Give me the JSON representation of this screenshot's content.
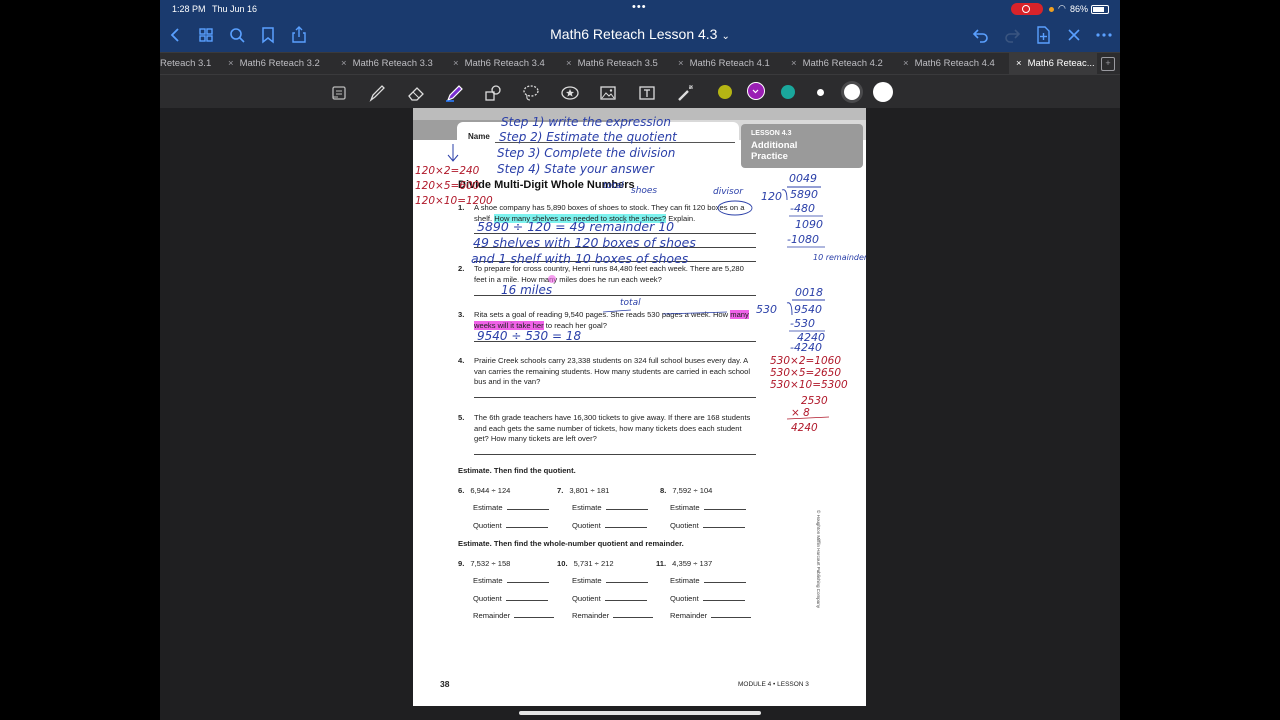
{
  "status_bar": {
    "time": "1:28 PM",
    "date": "Thu Jun 16",
    "battery": "86%"
  },
  "nav": {
    "title": "Math6 Reteach Lesson 4.3",
    "accent_color": "#5aa0ff",
    "icons": [
      "back-icon",
      "grid-icon",
      "search-icon",
      "bookmark-icon",
      "share-icon",
      "undo-icon",
      "redo-icon",
      "add-page-icon",
      "close-icon",
      "more-icon"
    ]
  },
  "tabs": [
    {
      "label": "Reteach 3.1",
      "closable": false
    },
    {
      "label": "Math6 Reteach 3.2",
      "closable": true
    },
    {
      "label": "Math6 Reteach 3.3",
      "closable": true
    },
    {
      "label": "Math6 Reteach 3.4",
      "closable": true
    },
    {
      "label": "Math6 Reteach 3.5",
      "closable": true
    },
    {
      "label": "Math6 Reteach 4.1",
      "closable": true
    },
    {
      "label": "Math6 Reteach 4.2",
      "closable": true
    },
    {
      "label": "Math6 Reteach 4.4",
      "closable": true
    },
    {
      "label": "Math6 Reteac...",
      "closable": true,
      "active": true
    }
  ],
  "toolbar": {
    "tools": [
      "reader-icon",
      "pen-icon",
      "eraser-icon",
      "highlighter-icon",
      "shapes-icon",
      "lasso-icon",
      "sticker-icon",
      "image-icon",
      "text-icon",
      "laser-icon"
    ],
    "colors": [
      "#b5b514",
      "#9a1fb4",
      "#1aa79c",
      "#ffffff",
      "#ffffff",
      "#ffffff"
    ]
  },
  "worksheet": {
    "name_label": "Name",
    "lesson_label": "LESSON 4.3",
    "lesson_title_1": "Additional",
    "lesson_title_2": "Practice",
    "title": "Divide Multi-Digit Whole Numbers",
    "q1": {
      "num": "1.",
      "a": "A shoe company has 5,890 boxes of shoes to stock. They can fit 120 boxes on a shelf.",
      "hl": "How many shelves are needed to stock the shoes?",
      "b": " Explain."
    },
    "q2": {
      "num": "2.",
      "text": "To prepare for cross country, Henri runs 84,480 feet each week. There are 5,280 feet in a mile. How many miles does he run each week?"
    },
    "q3": {
      "num": "3.",
      "a": "Rita sets a goal of reading 9,540 pages. She reads 530 pages a week. How ",
      "hl": "many weeks will it take her",
      "b": " to reach her goal?"
    },
    "q4": {
      "num": "4.",
      "text": "Prairie Creek schools carry 23,338 students on 324 full school buses every day. A van carries the remaining students. How many students are carried in each school bus and in the van?"
    },
    "q5": {
      "num": "5.",
      "text": "The 6th grade teachers have 16,300 tickets to give away. If there are 168 students and each gets the same number of tickets, how many tickets does each student get? How many tickets are left over?"
    },
    "section1": "Estimate. Then find the quotient.",
    "section2": "Estimate. Then find the whole-number quotient and remainder.",
    "problems": [
      {
        "num": "6.",
        "expr": "6,944 ÷ 124"
      },
      {
        "num": "7.",
        "expr": "3,801 ÷ 181"
      },
      {
        "num": "8.",
        "expr": "7,592 ÷ 104"
      },
      {
        "num": "9.",
        "expr": "7,532 ÷ 158"
      },
      {
        "num": "10.",
        "expr": "5,731 ÷ 212"
      },
      {
        "num": "11.",
        "expr": "4,359 ÷ 137"
      }
    ],
    "estimate_label": "Estimate",
    "quotient_label": "Quotient",
    "remainder_label": "Remainder",
    "page_number": "38",
    "footer": "MODULE 4 • LESSON 3",
    "copyright": "© Houghton Mifflin Harcourt Publishing Company"
  },
  "annotations": {
    "steps": [
      "Step 1) write the expression",
      "Step 2) Estimate the quotient",
      "Step 3) Complete the division",
      "Step 4) State your answer"
    ],
    "left_work": [
      "120×2=240",
      "120×5=600",
      "120×10=1200"
    ],
    "q1_work": [
      "total",
      "shoes",
      "divisor"
    ],
    "q1_answer_1": "5890 ÷ 120 = 49 remainder 10",
    "q1_answer_2": "49 shelves with 120 boxes of shoes",
    "q1_answer_3": "and 1 shelf with 10 boxes of shoes",
    "q2_answer": "16 miles",
    "q3_total": "total",
    "q3_answer": "9540 ÷ 530 = 18",
    "longdiv1": [
      "0049",
      "120",
      "5890",
      "-480",
      "1090",
      "-1080",
      "10 remainder"
    ],
    "longdiv2": [
      "0018",
      "530",
      "9540",
      "-530",
      "4240",
      "-4240"
    ],
    "mult_work": [
      "530×2=1060",
      "530×5=2650",
      "530×10=5300",
      "2530",
      "× 8",
      "4240"
    ],
    "colors": {
      "blue": "#2a3fa8",
      "red": "#b0182a"
    }
  }
}
